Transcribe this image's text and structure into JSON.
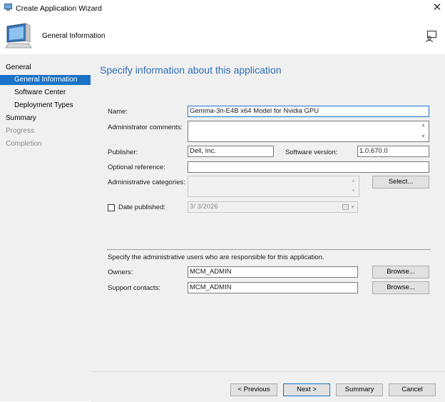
{
  "window": {
    "title": "Create Application Wizard"
  },
  "header": {
    "title": "General Information"
  },
  "nav": {
    "items": [
      {
        "label": "General"
      },
      {
        "label": "General Information"
      },
      {
        "label": "Software Center"
      },
      {
        "label": "Deployment Types"
      },
      {
        "label": "Summary"
      },
      {
        "label": "Progress"
      },
      {
        "label": "Completion"
      }
    ]
  },
  "page": {
    "heading": "Specify information about this application"
  },
  "form": {
    "name_label": "Name:",
    "name_value": "Gemma-3n-E4B x64 Model for Nvidia GPU",
    "comments_label": "Administrator comments:",
    "comments_value": "",
    "publisher_label": "Publisher:",
    "publisher_value": "Dell, Inc.",
    "version_label": "Software version:",
    "version_value": "1.0.670.0",
    "optref_label": "Optional reference:",
    "optref_value": "",
    "categories_label": "Administrative categories:",
    "select_button": "Select...",
    "date_label": "Date published:",
    "date_value": "3/  3/2026",
    "date_checked": false
  },
  "admins": {
    "description": "Specify the administrative users who are responsible for this application.",
    "owners_label": "Owners:",
    "owners_value": "MCM_ADMIN",
    "owners_browse": "Browse...",
    "support_label": "Support contacts:",
    "support_value": "MCM_ADMIN",
    "support_browse": "Browse..."
  },
  "footer": {
    "previous": "< Previous",
    "next": "Next >",
    "summary": "Summary",
    "cancel": "Cancel"
  },
  "icons": {
    "app_icon": "app-icon",
    "header_icon": "computer-icon",
    "help_icon": "help-person-icon",
    "close_icon": "close-icon"
  },
  "colors": {
    "accent": "#1a73c8",
    "heading": "#2f6db5",
    "panel": "#f0f0f0"
  }
}
